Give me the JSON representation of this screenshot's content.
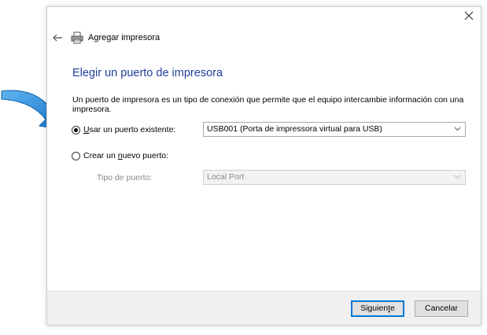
{
  "window": {
    "title": "Agregar impresora",
    "close_icon": "close-icon",
    "back_icon": "back-arrow-icon",
    "title_icon": "printer-icon"
  },
  "page": {
    "heading": "Elegir un puerto de impresora",
    "description": "Un puerto de impresora es un tipo de conexión que permite que el equipo intercambie información con una impresora."
  },
  "options": {
    "existing": {
      "label_pre": "",
      "label_ul": "U",
      "label_post": "sar un puerto existente:",
      "checked": true,
      "value": "USB001 (Porta de impressora virtual para USB)"
    },
    "new": {
      "label_pre": "Crear un ",
      "label_ul": "n",
      "label_post": "uevo puerto:",
      "checked": false,
      "type_label": "Tipo de puerto:",
      "value": "Local Port"
    }
  },
  "footer": {
    "next_pre": "Siguien",
    "next_ul": "t",
    "next_post": "e",
    "cancel": "Cancelar"
  },
  "colors": {
    "heading": "#1e3f9a",
    "default_button_border": "#0078d7",
    "annotation_arrow": "#1a86d8"
  }
}
